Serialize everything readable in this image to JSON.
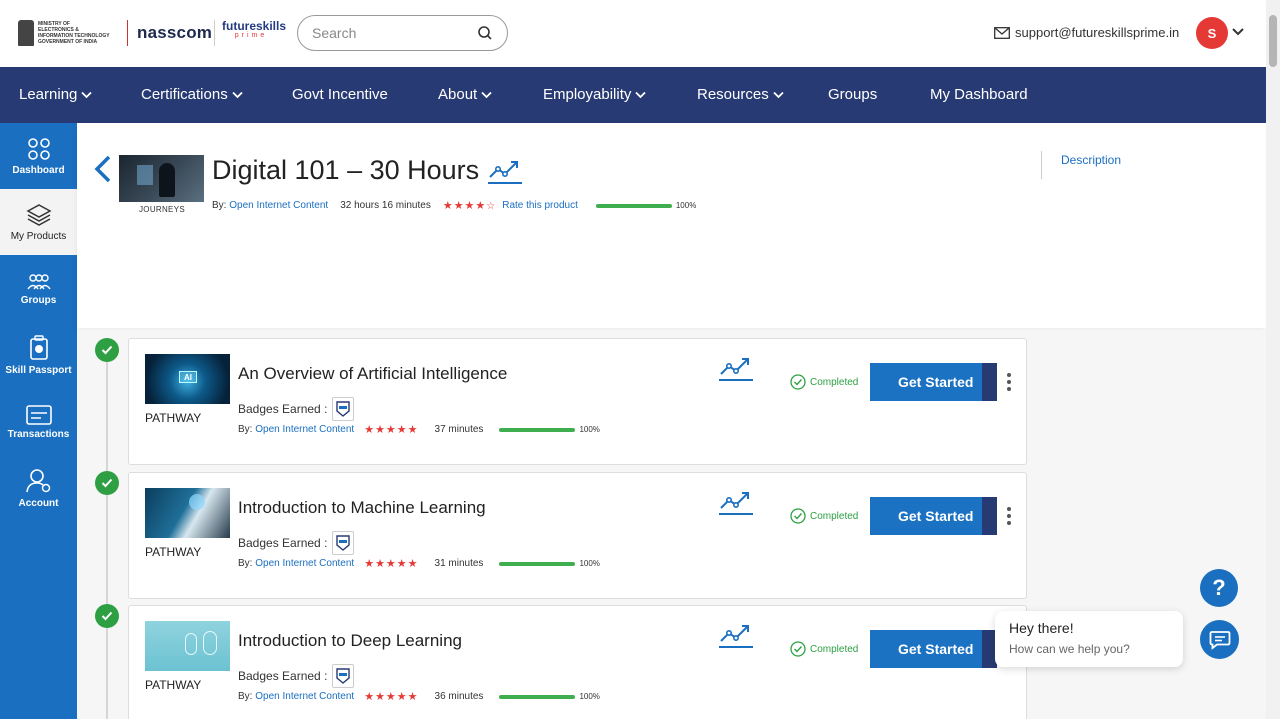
{
  "header": {
    "gov_logo_text": [
      "MINISTRY OF",
      "ELECTRONICS &",
      "INFORMATION TECHNOLOGY",
      "GOVERNMENT OF INDIA"
    ],
    "nasscom_logo": "nasscom",
    "futureskills_logo": "futureskills",
    "futureskills_sub": "prime",
    "search_placeholder": "Search",
    "support_email": "support@futureskillsprime.in",
    "avatar_initial": "S"
  },
  "nav": [
    {
      "label": "Learning",
      "dropdown": true
    },
    {
      "label": "Certifications",
      "dropdown": true
    },
    {
      "label": "Govt Incentive",
      "dropdown": false
    },
    {
      "label": "About",
      "dropdown": true
    },
    {
      "label": "Employability",
      "dropdown": true
    },
    {
      "label": "Resources",
      "dropdown": true
    },
    {
      "label": "Groups",
      "dropdown": false
    },
    {
      "label": "My Dashboard",
      "dropdown": false
    }
  ],
  "sidebar": [
    {
      "label": "Dashboard",
      "icon": "dashboard-icon",
      "active": false
    },
    {
      "label": "My Products",
      "icon": "layers-icon",
      "active": true
    },
    {
      "label": "Groups",
      "icon": "groups-icon",
      "active": false
    },
    {
      "label": "Skill Passport",
      "icon": "passport-icon",
      "active": false
    },
    {
      "label": "Transactions",
      "icon": "transactions-icon",
      "active": false
    },
    {
      "label": "Account",
      "icon": "account-icon",
      "active": false
    }
  ],
  "course": {
    "category": "JOURNEYS",
    "title": "Digital 101 – 30 Hours",
    "by_label": "By:",
    "provider": "Open Internet Content",
    "duration": "32 hours 16 minutes",
    "rating": 4,
    "rate_link": "Rate this product",
    "progress": 100,
    "progress_label": "100%",
    "description_tab": "Description"
  },
  "items": [
    {
      "type": "PATHWAY",
      "title": "An Overview of Artificial Intelligence",
      "badges_label": "Badges Earned :",
      "by_label": "By:",
      "provider": "Open Internet Content",
      "rating": 5,
      "duration": "37 minutes",
      "progress": 100,
      "progress_label": "100%",
      "status": "Completed",
      "button": "Get Started"
    },
    {
      "type": "PATHWAY",
      "title": "Introduction to Machine Learning",
      "badges_label": "Badges Earned :",
      "by_label": "By:",
      "provider": "Open Internet Content",
      "rating": 5,
      "duration": "31 minutes",
      "progress": 100,
      "progress_label": "100%",
      "status": "Completed",
      "button": "Get Started"
    },
    {
      "type": "PATHWAY",
      "title": "Introduction to Deep Learning",
      "badges_label": "Badges Earned :",
      "by_label": "By:",
      "provider": "Open Internet Content",
      "rating": 5,
      "duration": "36 minutes",
      "progress": 100,
      "progress_label": "100%",
      "status": "Completed",
      "button": "Get Started"
    }
  ],
  "chat": {
    "help_glyph": "?",
    "greeting": "Hey there!",
    "prompt": "How can we help you?"
  },
  "colors": {
    "nav": "#283a73",
    "sidebar": "#1a6fc0",
    "accent": "#1b71c2",
    "success": "#2ea043",
    "stars": "#e53935"
  }
}
